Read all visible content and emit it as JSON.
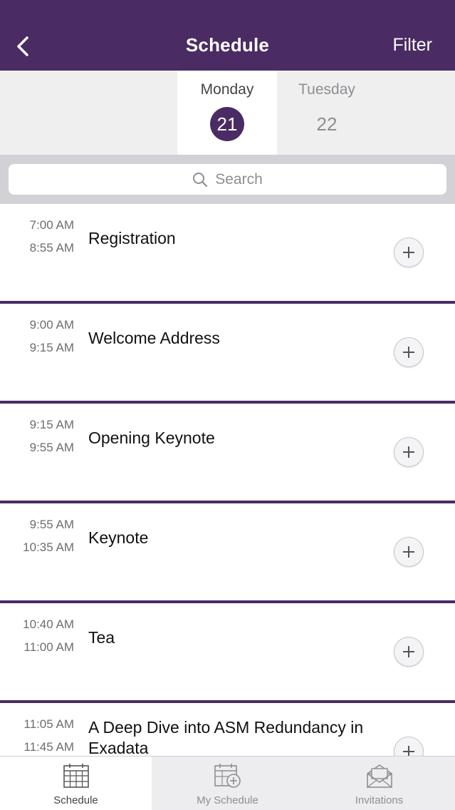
{
  "header": {
    "title": "Schedule",
    "filter_label": "Filter"
  },
  "days": [
    {
      "name": "Monday",
      "number": "21",
      "selected": true
    },
    {
      "name": "Tuesday",
      "number": "22",
      "selected": false
    }
  ],
  "search": {
    "placeholder": "Search"
  },
  "sessions": [
    {
      "start": "7:00 AM",
      "end": "8:55 AM",
      "title": "Registration"
    },
    {
      "start": "9:00 AM",
      "end": "9:15 AM",
      "title": "Welcome Address"
    },
    {
      "start": "9:15 AM",
      "end": "9:55 AM",
      "title": "Opening Keynote"
    },
    {
      "start": "9:55 AM",
      "end": "10:35 AM",
      "title": "Keynote"
    },
    {
      "start": "10:40 AM",
      "end": "11:00 AM",
      "title": "Tea"
    },
    {
      "start": "11:05 AM",
      "end": "11:45 AM",
      "title": "A Deep Dive into ASM Redundancy in Exadata"
    }
  ],
  "tabs": [
    {
      "label": "Schedule",
      "icon": "calendar-grid-icon",
      "active": true
    },
    {
      "label": "My Schedule",
      "icon": "calendar-add-icon",
      "active": false
    },
    {
      "label": "Invitations",
      "icon": "envelope-open-icon",
      "active": false
    }
  ],
  "colors": {
    "brand": "#4a2b63",
    "muted": "#8e8e93"
  }
}
